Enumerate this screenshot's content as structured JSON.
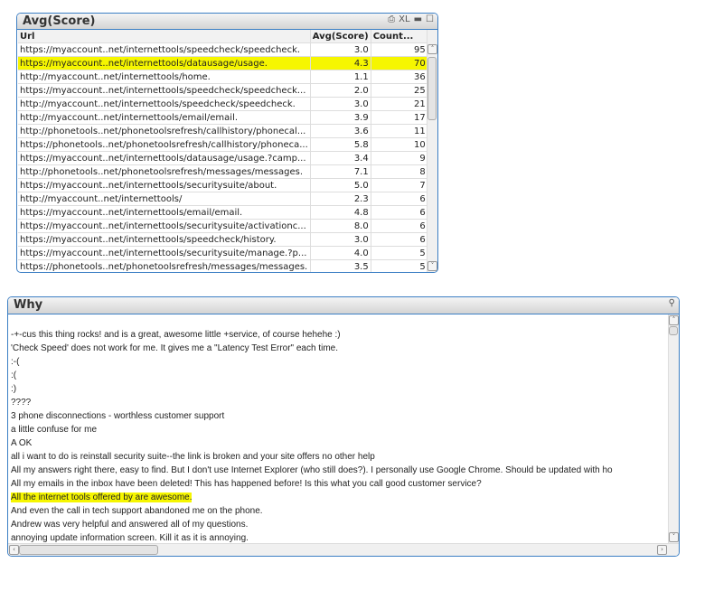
{
  "table_box": {
    "title": "Avg(Score)",
    "icons": [
      "print-icon",
      "xl-export-icon",
      "minimize-icon",
      "maximize-icon"
    ],
    "xl_label": "XL",
    "columns": [
      "Url",
      "Avg(Score)",
      "Count..."
    ],
    "rows": [
      [
        "https://myaccount..net/internettools/speedcheck/speedcheck.",
        "3.0",
        "95"
      ],
      [
        "https://myaccount..net/internettools/datausage/usage.",
        "4.3",
        "70"
      ],
      [
        "http://myaccount..net/internettools/home.",
        "1.1",
        "36"
      ],
      [
        "https://myaccount..net/internettools/speedcheck/speedcheck...",
        "2.0",
        "25"
      ],
      [
        "http://myaccount..net/internettools/speedcheck/speedcheck.",
        "3.0",
        "21"
      ],
      [
        "http://myaccount..net/internettools/email/email.",
        "3.9",
        "17"
      ],
      [
        "http://phonetools..net/phonetoolsrefresh/callhistory/phonecal...",
        "3.6",
        "11"
      ],
      [
        "https://phonetools..net/phonetoolsrefresh/callhistory/phoneca...",
        "5.8",
        "10"
      ],
      [
        "https://myaccount..net/internettools/datausage/usage.?camp...",
        "3.4",
        "9"
      ],
      [
        "http://phonetools..net/phonetoolsrefresh/messages/messages.",
        "7.1",
        "8"
      ],
      [
        "https://myaccount..net/internettools/securitysuite/about.",
        "5.0",
        "7"
      ],
      [
        "http://myaccount..net/internettools/",
        "2.3",
        "6"
      ],
      [
        "https://myaccount..net/internettools/email/email.",
        "4.8",
        "6"
      ],
      [
        "https://myaccount..net/internettools/securitysuite/activationc...",
        "8.0",
        "6"
      ],
      [
        "https://myaccount..net/internettools/speedcheck/history.",
        "3.0",
        "6"
      ],
      [
        "https://myaccount..net/internettools/securitysuite/manage.?p...",
        "4.0",
        "5"
      ],
      [
        "https://phonetools..net/phonetoolsrefresh/messages/messages.",
        "3.5",
        "5"
      ]
    ],
    "highlight_row": 1,
    "highlight_color": "#f6f600"
  },
  "why_box": {
    "title": "Why",
    "lines": [
      "",
      "-+-cus this thing rocks! and is a great, awesome little +service, of course hehehe :)",
      "'Check Speed' does not work for me.  It gives me a \"Latency Test Error\" each time.",
      ":-(",
      ":(",
      ":)",
      "????",
      "3 phone disconnections - worthless customer support",
      "a little confuse for me",
      "A OK",
      "all i want to do is reinstall  security suite--the link is broken and your site offers no other help",
      "All my answers right there, easy to find. But I don't use Internet Explorer (who still does?). I personally use Google Chrome. Should be updated with ho",
      "All my emails in the inbox have been deleted!  This has happened before!  Is this what you call good customer service?",
      "All the internet tools offered by  are awesome.",
      "And even the call in tech support abandoned me on the phone.",
      "Andrew was very helpful and answered all of my questions.",
      "annoying update information screen. Kill it as it is annoying."
    ],
    "highlight_line": 13
  }
}
